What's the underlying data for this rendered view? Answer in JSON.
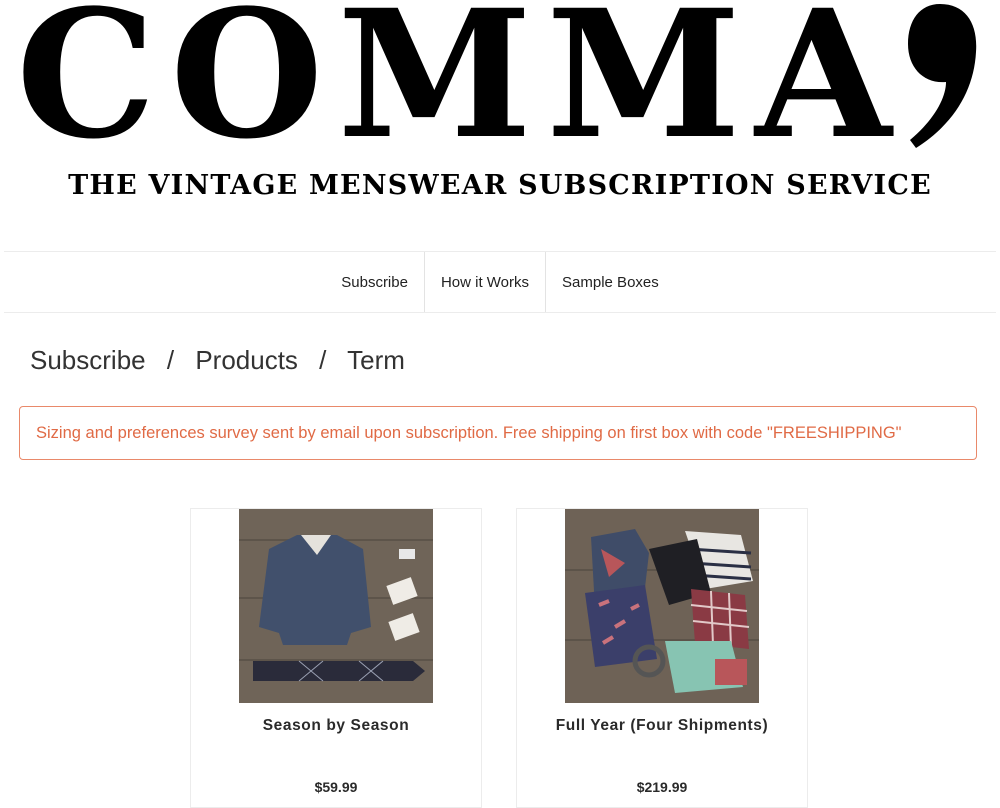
{
  "brand": {
    "logo_text": "COMMA",
    "tagline": "THE VINTAGE MENSWEAR SUBSCRIPTION SERVICE"
  },
  "nav": {
    "items": [
      {
        "label": "Subscribe"
      },
      {
        "label": "How it Works"
      },
      {
        "label": "Sample Boxes"
      }
    ]
  },
  "breadcrumb": {
    "items": [
      "Subscribe",
      "Products",
      "Term"
    ],
    "separator": "/"
  },
  "notice": {
    "text": "Sizing and preferences survey sent by email upon subscription. Free shipping on first box with code \"FREESHIPPING\"",
    "color": "#e06a45"
  },
  "products": [
    {
      "title": "Season by Season",
      "price": "$59.99"
    },
    {
      "title": "Full Year (Four Shipments)",
      "price": "$219.99"
    }
  ]
}
